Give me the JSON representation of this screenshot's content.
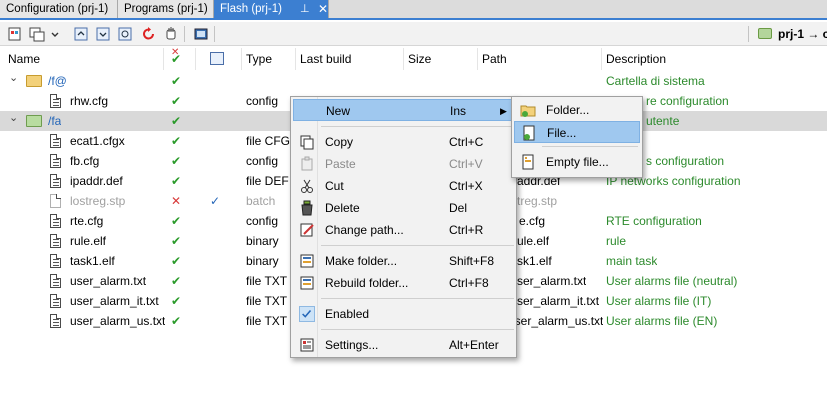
{
  "tabs": [
    {
      "label": "Configuration (prj-1)"
    },
    {
      "label": "Programs (prj-1)"
    },
    {
      "label": "Flash (prj-1)"
    }
  ],
  "tab_pin_icon": "pin-icon",
  "tab_close_icon": "close-icon",
  "toolbar": {
    "project_label": "prj-1 → c"
  },
  "columns": {
    "name": "Name",
    "type": "Type",
    "last_build": "Last build",
    "size": "Size",
    "path": "Path",
    "description": "Description"
  },
  "rows": [
    {
      "name": "/f@",
      "type": "",
      "path": "",
      "description": "Cartella di sistema",
      "status": "check"
    },
    {
      "name": "rhw.cfg",
      "type": "config",
      "path": "",
      "description": "re configuration",
      "status": "check"
    },
    {
      "name": "/fa",
      "type": "",
      "path": "",
      "description": "utente",
      "status": "check"
    },
    {
      "name": "ecat1.cfgx",
      "type": "file CFGX",
      "path": "",
      "description": "",
      "status": "check"
    },
    {
      "name": "fb.cfg",
      "type": "config",
      "path": "",
      "description": "s configuration",
      "status": "check"
    },
    {
      "name": "ipaddr.def",
      "type": "file DEF",
      "path": "addr.def",
      "description": "IP networks configuration",
      "status": "check"
    },
    {
      "name": "lostreg.stp",
      "type": "batch",
      "path": "treg.stp",
      "description": "",
      "status": "x"
    },
    {
      "name": "rte.cfg",
      "type": "config",
      "path": "e.cfg",
      "description": "RTE configuration",
      "status": "check"
    },
    {
      "name": "rule.elf",
      "type": "binary",
      "path": "ule.elf",
      "description": "rule",
      "status": "check"
    },
    {
      "name": "task1.elf",
      "type": "binary",
      "path": "sk1.elf",
      "description": "main task",
      "status": "check"
    },
    {
      "name": "user_alarm.txt",
      "type": "file TXT",
      "path": "ser_alarm.txt",
      "description": "User alarms file (neutral)",
      "status": "check"
    },
    {
      "name": "user_alarm_it.txt",
      "type": "file TXT",
      "path": "ser_alarm_it.txt",
      "description": "User alarms file (IT)",
      "status": "check"
    },
    {
      "name": "user_alarm_us.txt",
      "type": "file TXT",
      "path": "user_alarm_us.txt",
      "description": "User alarms file (EN)",
      "status": "check"
    }
  ],
  "context_menu": {
    "items": [
      {
        "label": "New",
        "shortcut": "Ins",
        "icon": "none",
        "state": "highlighted"
      },
      {
        "label": "Copy",
        "shortcut": "Ctrl+C",
        "icon": "copy-icon"
      },
      {
        "label": "Paste",
        "shortcut": "Ctrl+V",
        "icon": "paste-icon",
        "state": "disabled"
      },
      {
        "label": "Cut",
        "shortcut": "Ctrl+X",
        "icon": "cut-icon"
      },
      {
        "label": "Delete",
        "shortcut": "Del",
        "icon": "delete-icon"
      },
      {
        "label": "Change path...",
        "shortcut": "Ctrl+R",
        "icon": "change-path-icon"
      },
      {
        "label": "Make folder...",
        "shortcut": "Shift+F8",
        "icon": "make-folder-icon"
      },
      {
        "label": "Rebuild folder...",
        "shortcut": "Ctrl+F8",
        "icon": "rebuild-folder-icon"
      },
      {
        "label": "Enabled",
        "shortcut": "",
        "icon": "check-icon"
      },
      {
        "label": "Settings...",
        "shortcut": "Alt+Enter",
        "icon": "settings-icon"
      }
    ]
  },
  "submenu": {
    "items": [
      {
        "label": "Folder...",
        "icon": "new-folder-icon"
      },
      {
        "label": "File...",
        "icon": "new-file-icon",
        "state": "highlighted"
      },
      {
        "label": "Empty file...",
        "icon": "empty-file-icon"
      }
    ]
  },
  "colors": {
    "accent": "#3c7fd1",
    "highlight": "#9fc8ef",
    "description_green": "#2c8a2c"
  }
}
